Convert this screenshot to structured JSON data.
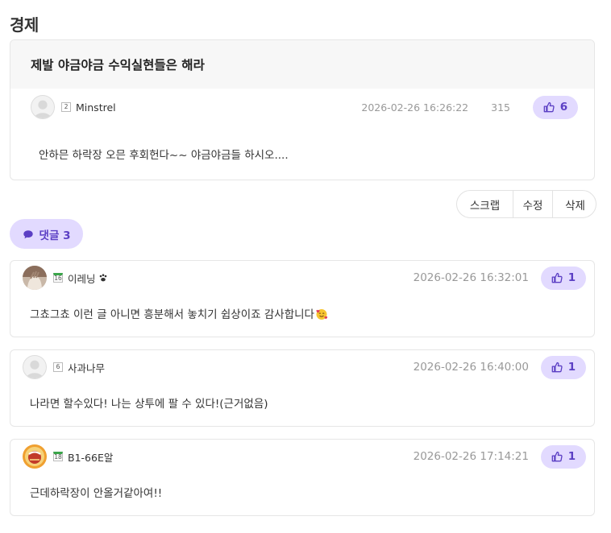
{
  "board": {
    "title": "경제"
  },
  "post": {
    "subject": "제발 야금야금 수익실현들은 해라",
    "author_level": "2",
    "author": "Minstrel",
    "date": "2026-02-26 16:26:22",
    "hits": "315",
    "likes": "6",
    "body": "안하믄 하락장 오믄 후회헌다~~ 야금야금들 하시오...."
  },
  "actions": {
    "scrap": "스크랩",
    "edit": "수정",
    "delete": "삭제"
  },
  "comments_toggle": {
    "label": "댓글 3"
  },
  "comments": [
    {
      "level": "16",
      "author": "이레닝",
      "author_icon": "paw-icon",
      "date": "2026-02-26 16:32:01",
      "likes": "1",
      "body": "그쵸그쵸 이런 글 아니면 흥분해서 놓치기 쉽상이죠 감사합니다",
      "body_emoji": "smiling-face-with-hearts"
    },
    {
      "level": "6",
      "author": "사과나무",
      "date": "2026-02-26 16:40:00",
      "likes": "1",
      "body": "나라면 할수있다! 나는 상투에 팔 수 있다!(근거없음)"
    },
    {
      "level": "18",
      "author": "B1-66E알",
      "date": "2026-02-26 17:14:21",
      "likes": "1",
      "body": "근데하락장이 안올거같아여!!"
    }
  ],
  "colors": {
    "accent": "#5b3fc4",
    "pill_bg": "#e2daff",
    "level_green": "#3aa64a"
  }
}
